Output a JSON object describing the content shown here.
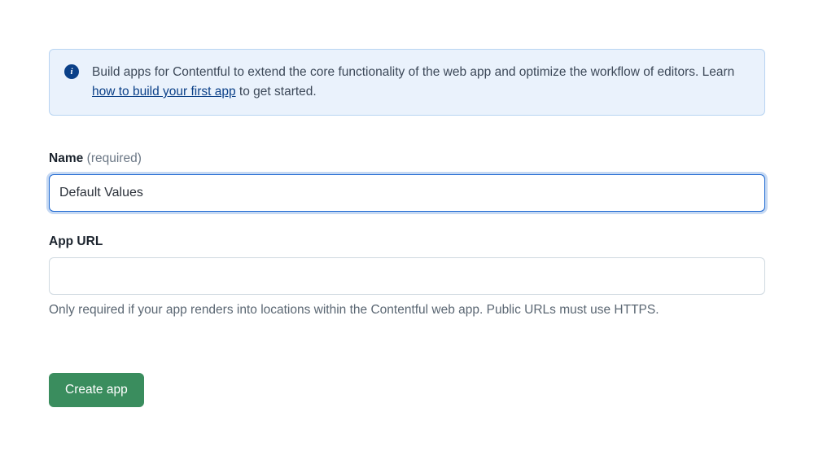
{
  "banner": {
    "text_before_link": "Build apps for Contentful to extend the core functionality of the web app and optimize the workflow of editors. Learn ",
    "link_text": "how to build your first app",
    "text_after_link": " to get started."
  },
  "form": {
    "name": {
      "label": "Name",
      "required_text": "(required)",
      "value": "Default Values"
    },
    "app_url": {
      "label": "App URL",
      "value": "",
      "help": "Only required if your app renders into locations within the Contentful web app. Public URLs must use HTTPS."
    },
    "submit_label": "Create app"
  }
}
